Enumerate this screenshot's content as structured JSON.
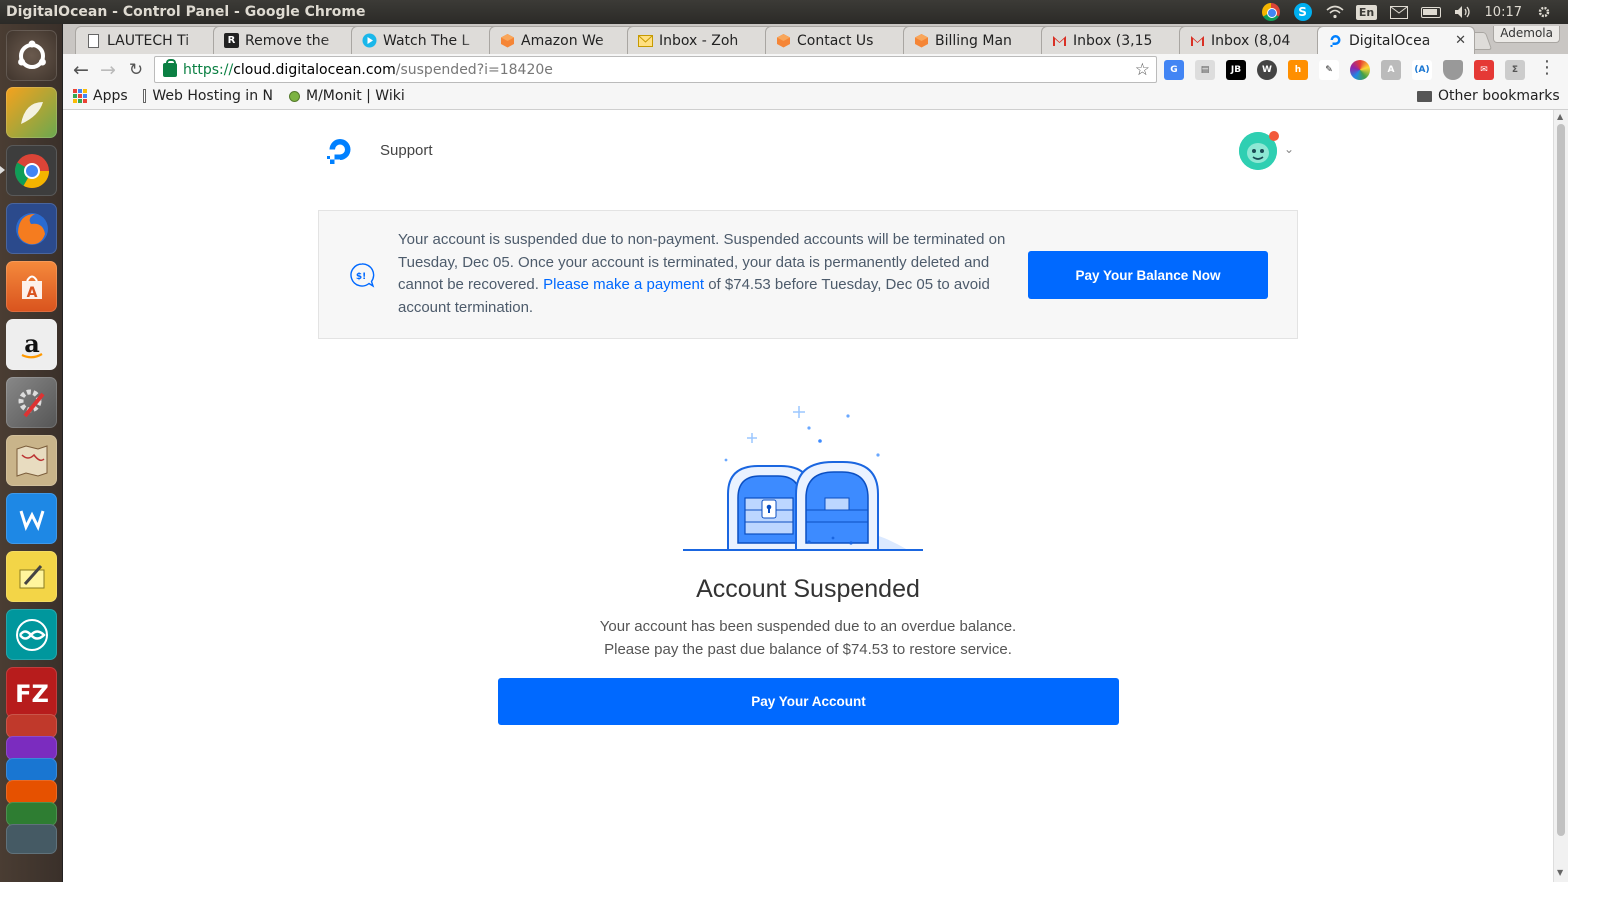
{
  "os": {
    "window_title": "DigitalOcean - Control Panel - Google Chrome",
    "keyboard_layout": "En",
    "clock": "10:17"
  },
  "browser": {
    "tabs": [
      {
        "label": "LAUTECH Ti",
        "icon": "page-icon"
      },
      {
        "label": "Remove the",
        "icon": "r-icon"
      },
      {
        "label": "Watch The L",
        "icon": "play-icon"
      },
      {
        "label": "Amazon We",
        "icon": "aws-icon"
      },
      {
        "label": "Inbox - Zoh",
        "icon": "mail-icon"
      },
      {
        "label": "Contact Us",
        "icon": "aws-icon"
      },
      {
        "label": "Billing Man",
        "icon": "aws-icon"
      },
      {
        "label": "Inbox (3,15",
        "icon": "gmail-icon"
      },
      {
        "label": "Inbox (8,04",
        "icon": "gmail-icon"
      },
      {
        "label": "DigitalOcea",
        "icon": "digitalocean-icon",
        "active": true
      }
    ],
    "profile_name": "Ademola",
    "url": {
      "scheme": "https://",
      "host": "cloud.digitalocean.com",
      "path": "/suspended?i=18420e"
    },
    "bookmarks": {
      "apps": "Apps",
      "items": [
        "Web Hosting in N",
        "M/Monit | Wiki"
      ],
      "other": "Other bookmarks"
    }
  },
  "page": {
    "nav": {
      "support": "Support"
    },
    "alert": {
      "text_before_link": "Your account is suspended due to non-payment. Suspended accounts will be terminated on Tuesday, Dec 05. Once your account is terminated, your data is permanently deleted and cannot be recovered.",
      "link": "Please make a payment",
      "text_after_link": "of $74.53 before Tuesday, Dec 05 to avoid account termination.",
      "button": "Pay Your Balance Now"
    },
    "heading": "Account Suspended",
    "subtext_line1": "Your account has been suspended due to an overdue balance.",
    "subtext_line2": "Please pay the past due balance of $74.53 to restore service.",
    "pay_button": "Pay Your Account"
  },
  "colors": {
    "primary": "#0069ff",
    "alert_bg": "#f7f7f7",
    "secure_green": "#0b8043"
  }
}
